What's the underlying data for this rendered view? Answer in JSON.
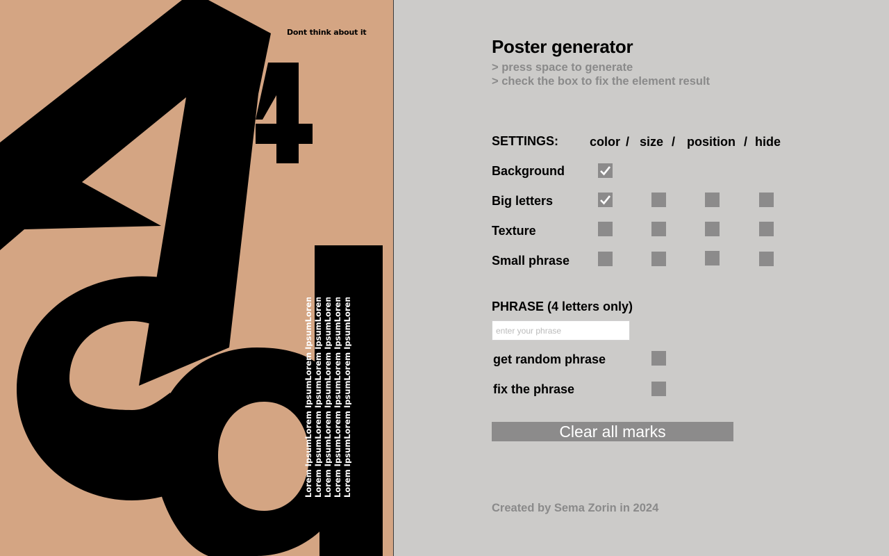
{
  "poster": {
    "tagline": "Dont think about it",
    "big_letters": [
      "4",
      "4",
      "c",
      "a"
    ],
    "small_phrase_lines": [
      "Lorem IpsumLorem IpsumLorem IpsumLorem Ipsum",
      "Lorem IpsumLorem IpsumLorem IpsumLorem Ipsum",
      "Lorem IpsumLorem IpsumLorem IpsumLorem Ipsum",
      "Lorem IpsumLorem IpsumLorem IpsumLorem Ipsum",
      "Lorem IpsumLorem IpsumLorem IpsumLorem Ipsum"
    ],
    "background_color": "#d4a583",
    "letter_color": "#000000"
  },
  "panel": {
    "title": "Poster generator",
    "hints": [
      "> press space to generate",
      "> check the box to fix the element result"
    ],
    "settings_label": "SETTINGS:",
    "columns": [
      "color",
      "/",
      "size",
      "/",
      "position",
      "/",
      "hide"
    ],
    "rows": [
      {
        "label": "Background",
        "checks": [
          true
        ]
      },
      {
        "label": "Big letters",
        "checks": [
          true,
          false,
          false,
          false
        ]
      },
      {
        "label": "Texture",
        "checks": [
          false,
          false,
          false,
          false
        ]
      },
      {
        "label": "Small phrase",
        "checks": [
          false,
          false,
          false,
          false
        ]
      }
    ],
    "phrase_label": "PHRASE (4 letters only)",
    "phrase_placeholder": "enter your phrase",
    "phrase_value": "",
    "options": [
      {
        "label": "get random phrase",
        "checked": false
      },
      {
        "label": "fix the phrase",
        "checked": false
      }
    ],
    "clear_button": "Clear all marks",
    "credit": "Created by Sema Zorin in 2024",
    "checkbox_color": "#8c8b8b",
    "panel_background": "#cccbc9"
  }
}
